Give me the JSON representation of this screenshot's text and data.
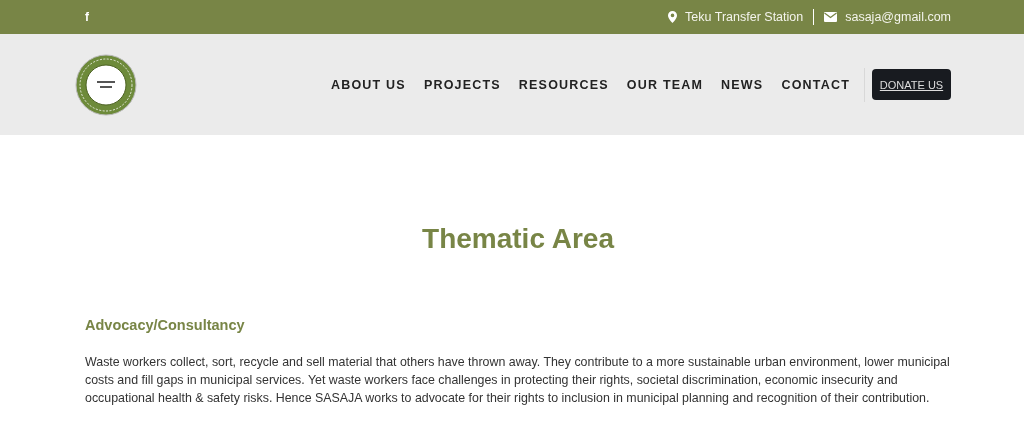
{
  "top_bar": {
    "facebook": "f",
    "location": "Teku Transfer Station",
    "email": "sasaja@gmail.com"
  },
  "nav": {
    "items": [
      {
        "label": "ABOUT US"
      },
      {
        "label": "PROJECTS"
      },
      {
        "label": "RESOURCES"
      },
      {
        "label": "OUR TEAM"
      },
      {
        "label": "NEWS"
      },
      {
        "label": "CONTACT"
      }
    ],
    "button": "DONATE US"
  },
  "page": {
    "title": "Thematic Area",
    "sections": [
      {
        "heading": "Advocacy/Consultancy",
        "text": "Waste workers collect, sort, recycle and sell material that others have thrown away. They contribute to a more sustainable urban environment, lower municipal costs and fill gaps in municipal services. Yet waste workers face challenges in protecting their rights, societal discrimination, economic insecurity and occupational health & safety risks. Hence SASAJA works to advocate for their rights to inclusion in municipal planning and recognition of their contribution."
      }
    ]
  }
}
